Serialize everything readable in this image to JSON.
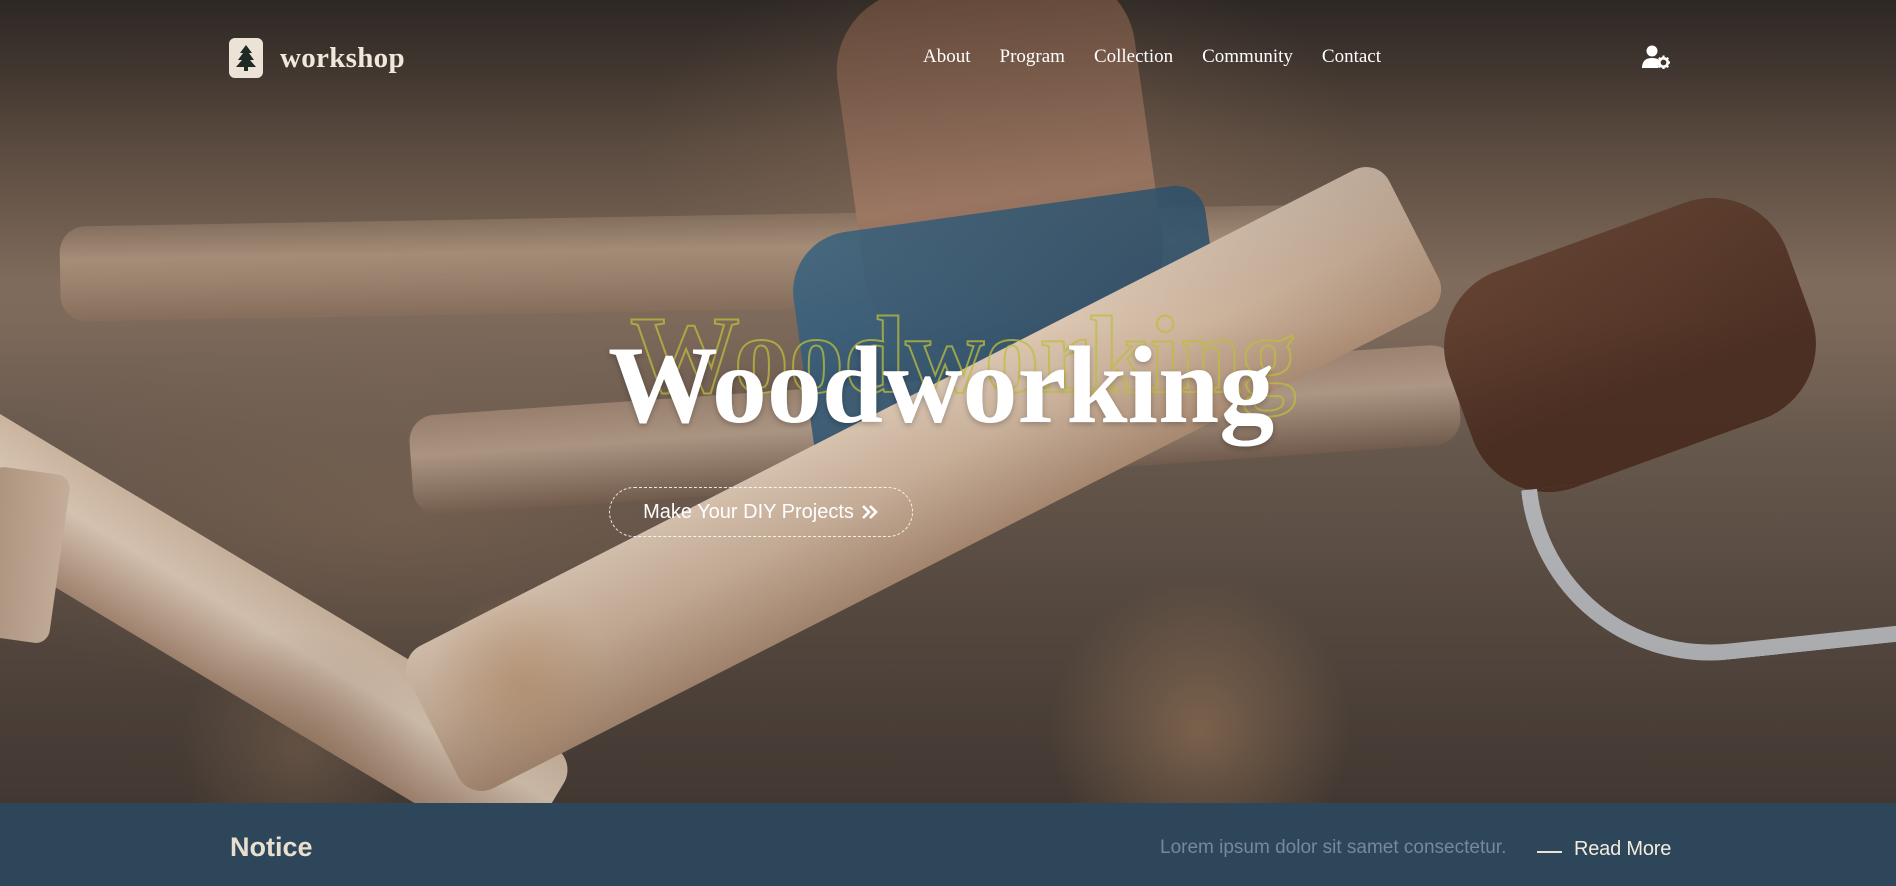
{
  "brand": {
    "name": "workshop",
    "icon": "tree-icon"
  },
  "nav": {
    "items": [
      {
        "label": "About"
      },
      {
        "label": "Program"
      },
      {
        "label": "Collection"
      },
      {
        "label": "Community"
      },
      {
        "label": "Contact"
      }
    ],
    "user_icon": "user-settings-icon"
  },
  "hero": {
    "title": "Woodworking",
    "cta_label": "Make Your DIY Projects",
    "cta_icon": "double-chevron-right-icon"
  },
  "notice": {
    "title": "Notice",
    "text": "Lorem ipsum dolor sit samet consectetur.",
    "link_label": "Read More"
  },
  "colors": {
    "notice_bg": "#2e4659",
    "brand_text": "#f1e8dc",
    "outline_text": "#bebe3c"
  }
}
